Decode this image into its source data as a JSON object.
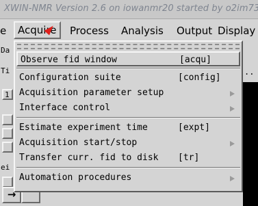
{
  "window": {
    "title": "XWIN-NMR Version 2.6 on iowanmr20 started by o2im73"
  },
  "menubar": {
    "items": [
      {
        "name": "menu-edge",
        "label": "e"
      },
      {
        "name": "menu-acquire",
        "label": "Acquire"
      },
      {
        "name": "menu-process",
        "label": "Process"
      },
      {
        "name": "menu-analysis",
        "label": "Analysis"
      },
      {
        "name": "menu-output",
        "label": "Output"
      },
      {
        "name": "menu-display",
        "label": "Display"
      }
    ]
  },
  "background": {
    "frag_da": "Da",
    "frag_ti": "Ti",
    "frag_1": "1",
    "frag_ei": "ei",
    "dots": "..",
    "arrow_right": "→"
  },
  "acquire_menu": {
    "items": [
      {
        "label": "Observe fid window",
        "accel": "[acqu]",
        "submenu": false
      },
      {
        "label": "Configuration suite",
        "accel": "[config]",
        "submenu": false
      },
      {
        "label": "Acquisition parameter setup",
        "accel": "",
        "submenu": true
      },
      {
        "label": "Interface control",
        "accel": "",
        "submenu": true
      },
      {
        "label": "Estimate experiment time",
        "accel": "[expt]",
        "submenu": false
      },
      {
        "label": "Acquisition start/stop",
        "accel": "",
        "submenu": true
      },
      {
        "label": "Transfer curr. fid to disk",
        "accel": "[tr]",
        "submenu": false
      },
      {
        "label": "Automation procedures",
        "accel": "",
        "submenu": true
      }
    ]
  },
  "colors": {
    "cursor": "#e0201c",
    "title_text": "#7f8590",
    "background": "#d4d4d4"
  },
  "icons": {
    "cursor": "mouse-pointer-icon",
    "submenu": "submenu-arrow-icon"
  }
}
